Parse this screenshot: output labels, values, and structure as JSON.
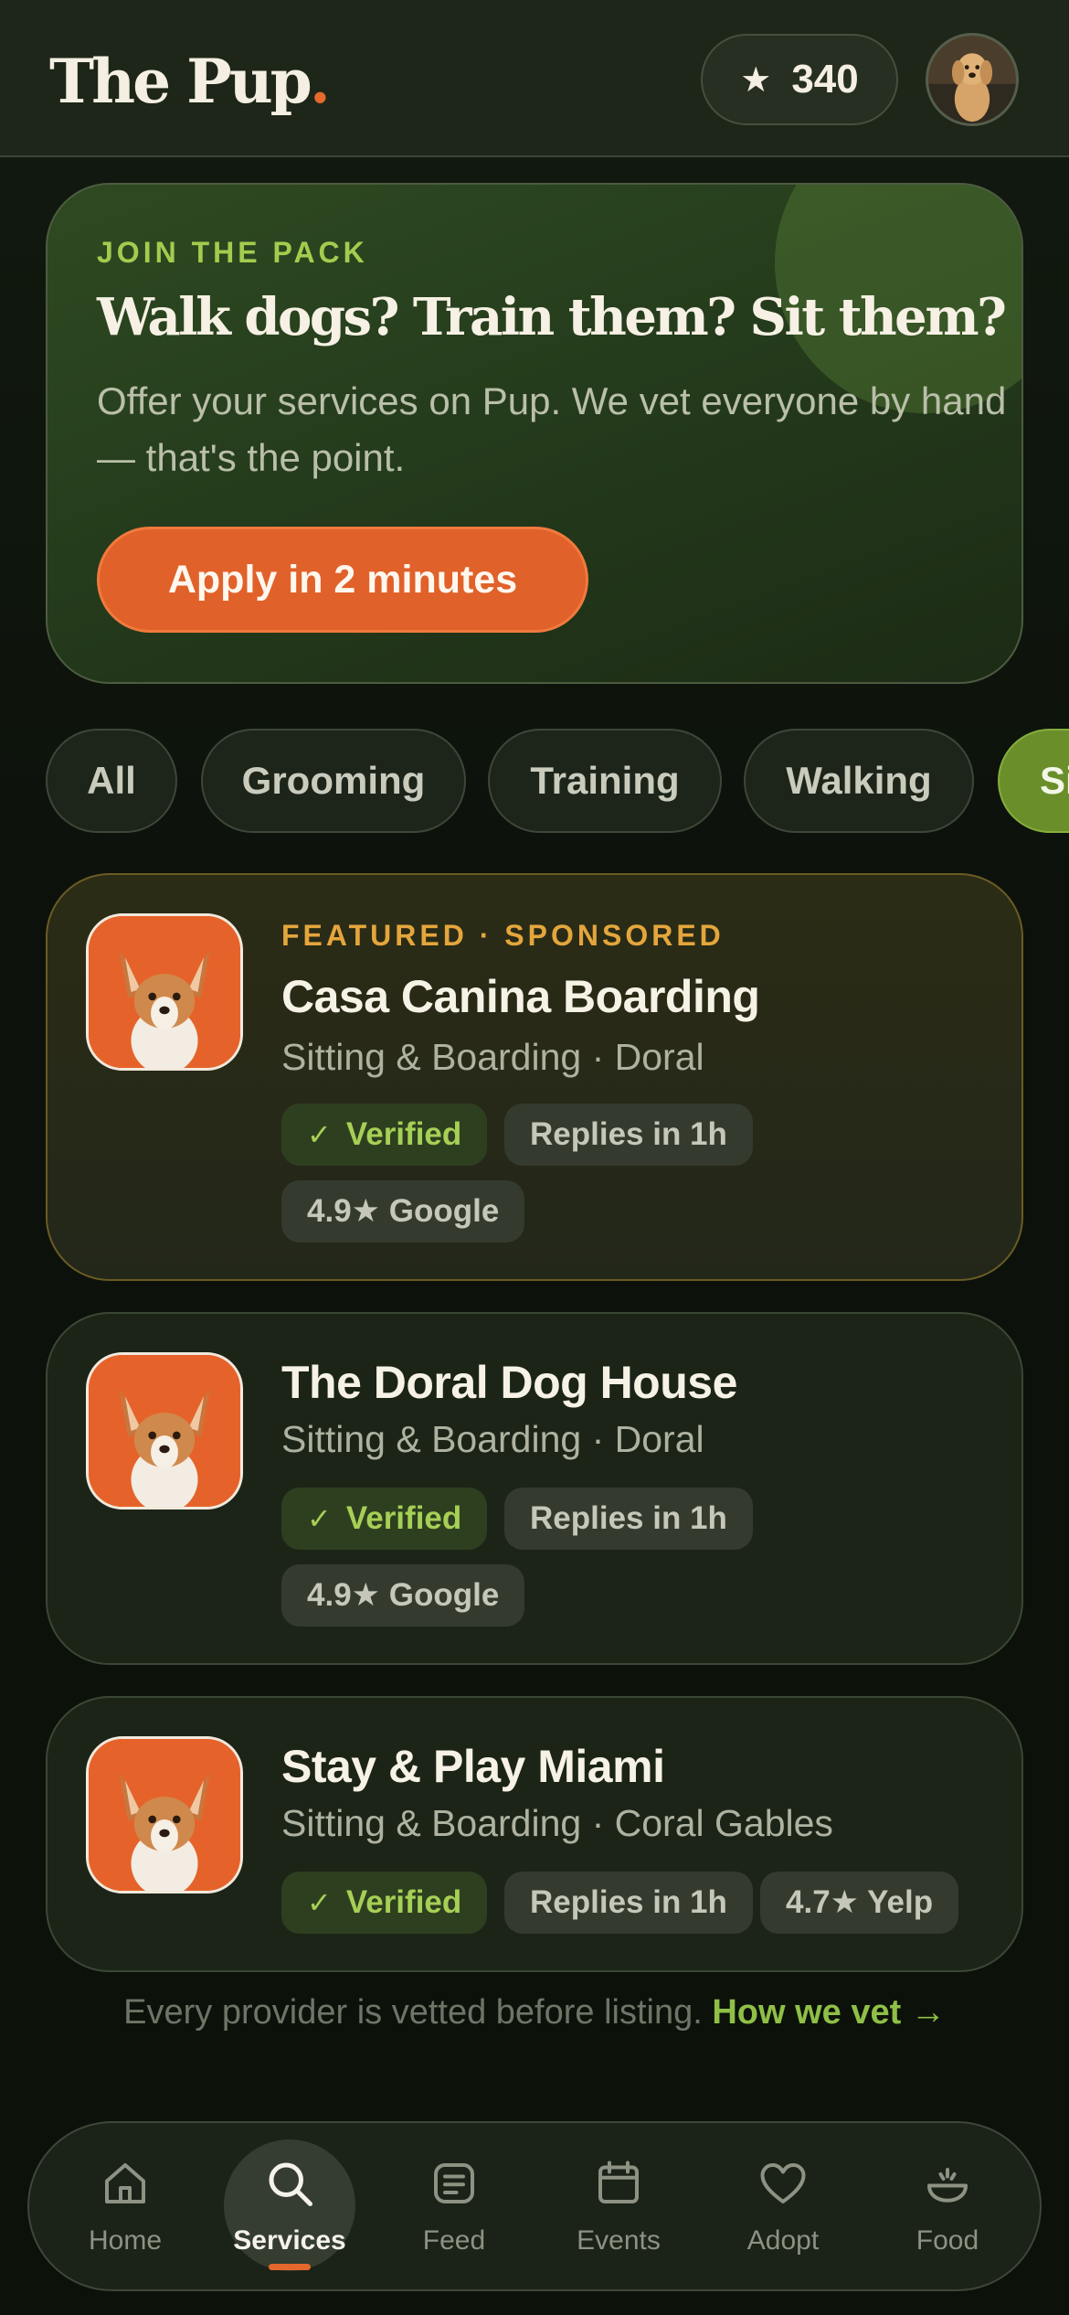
{
  "header": {
    "logo_text": "The Pup",
    "logo_dot": ".",
    "points_value": "340"
  },
  "join": {
    "eyebrow": "JOIN THE PACK",
    "headline": "Walk dogs? Train them? Sit them?",
    "body": "Offer your services on Pup. We vet everyone by hand — that's the point.",
    "cta": "Apply in 2 minutes"
  },
  "chips": [
    {
      "label": "All",
      "active": false
    },
    {
      "label": "Grooming",
      "active": false
    },
    {
      "label": "Training",
      "active": false
    },
    {
      "label": "Walking",
      "active": false
    },
    {
      "label": "Si",
      "active": true
    }
  ],
  "providers": [
    {
      "kicker": "FEATURED · SPONSORED",
      "name": "Casa Canina Boarding",
      "sub": "Sitting & Boarding · Doral",
      "verified": "Verified",
      "replies": "Replies in 1h",
      "rating": "4.9★ Google"
    },
    {
      "name": "The Doral Dog House",
      "sub": "Sitting & Boarding · Doral",
      "verified": "Verified",
      "replies": "Replies in 1h",
      "rating": "4.9★ Google"
    },
    {
      "name": "Stay & Play Miami",
      "sub": "Sitting & Boarding · Coral Gables",
      "verified": "Verified",
      "replies": "Replies in 1h",
      "rating": "4.7★ Yelp"
    }
  ],
  "vet_note": {
    "text": "Every provider is vetted before listing.",
    "link": "How we vet →"
  },
  "nav": [
    {
      "label": "Home",
      "icon": "home-icon",
      "active": false
    },
    {
      "label": "Services",
      "icon": "search-icon",
      "active": true
    },
    {
      "label": "Feed",
      "icon": "feed-icon",
      "active": false
    },
    {
      "label": "Events",
      "icon": "calendar-icon",
      "active": false
    },
    {
      "label": "Adopt",
      "icon": "heart-icon",
      "active": false
    },
    {
      "label": "Food",
      "icon": "bowl-icon",
      "active": false
    }
  ],
  "colors": {
    "accent_orange": "#e1612a",
    "accent_green": "#a3cc4e",
    "featured_gold": "#e4a63c",
    "background": "#0d140c"
  }
}
